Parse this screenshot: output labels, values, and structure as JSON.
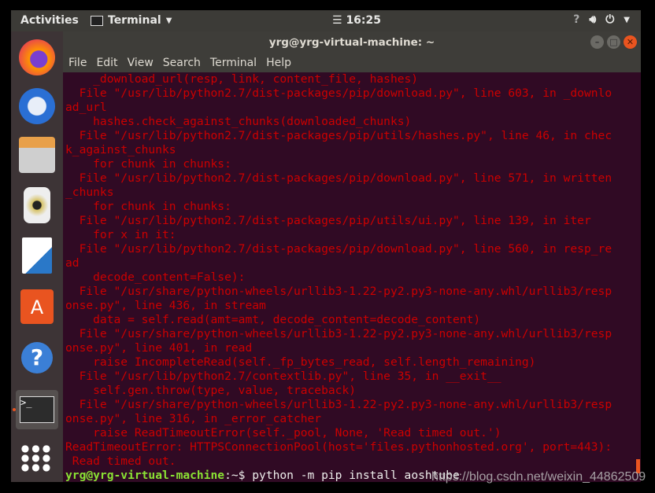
{
  "topbar": {
    "activities": "Activities",
    "app_name": "Terminal",
    "clock": "16:25"
  },
  "window": {
    "title": "yrg@yrg-virtual-machine: ~"
  },
  "menu": [
    "File",
    "Edit",
    "View",
    "Search",
    "Terminal",
    "Help"
  ],
  "terminal": {
    "lines": [
      "    _download_url(resp, link, content_file, hashes)",
      "  File \"/usr/lib/python2.7/dist-packages/pip/download.py\", line 603, in _downlo",
      "ad_url",
      "    hashes.check_against_chunks(downloaded_chunks)",
      "  File \"/usr/lib/python2.7/dist-packages/pip/utils/hashes.py\", line 46, in chec",
      "k_against_chunks",
      "    for chunk in chunks:",
      "  File \"/usr/lib/python2.7/dist-packages/pip/download.py\", line 571, in written",
      "_chunks",
      "    for chunk in chunks:",
      "  File \"/usr/lib/python2.7/dist-packages/pip/utils/ui.py\", line 139, in iter",
      "    for x in it:",
      "  File \"/usr/lib/python2.7/dist-packages/pip/download.py\", line 560, in resp_re",
      "ad",
      "    decode_content=False):",
      "  File \"/usr/share/python-wheels/urllib3-1.22-py2.py3-none-any.whl/urllib3/resp",
      "onse.py\", line 436, in stream",
      "    data = self.read(amt=amt, decode_content=decode_content)",
      "  File \"/usr/share/python-wheels/urllib3-1.22-py2.py3-none-any.whl/urllib3/resp",
      "onse.py\", line 401, in read",
      "    raise IncompleteRead(self._fp_bytes_read, self.length_remaining)",
      "  File \"/usr/lib/python2.7/contextlib.py\", line 35, in __exit__",
      "    self.gen.throw(type, value, traceback)",
      "  File \"/usr/share/python-wheels/urllib3-1.22-py2.py3-none-any.whl/urllib3/resp",
      "onse.py\", line 316, in _error_catcher",
      "    raise ReadTimeoutError(self._pool, None, 'Read timed out.')",
      "ReadTimeoutError: HTTPSConnectionPool(host='files.pythonhosted.org', port=443):",
      " Read timed out."
    ],
    "prompt_user": "yrg@yrg-virtual-machine",
    "prompt_path": ":~$ ",
    "command": "python -m pip install aoshtube"
  },
  "watermark": "https://blog.csdn.net/weixin_44862509",
  "colors": {
    "terminal_bg": "#300a24",
    "error_text": "#cc0000",
    "accent": "#e95420"
  }
}
